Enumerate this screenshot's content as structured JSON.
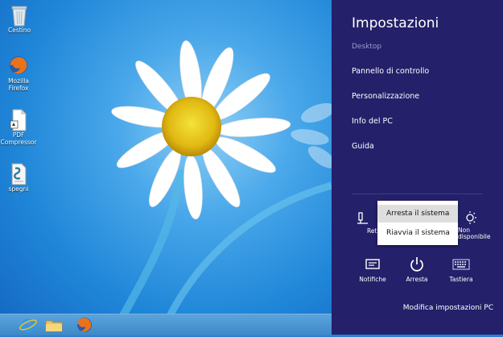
{
  "desktop": {
    "icons": [
      {
        "label": "Cestino"
      },
      {
        "label": "Mozilla Firefox"
      },
      {
        "label": "PDF Compressor"
      },
      {
        "label": "spegni"
      }
    ]
  },
  "panel": {
    "title": "Impostazioni",
    "subtitle": "Desktop",
    "links": [
      {
        "label": "Pannello di controllo"
      },
      {
        "label": "Personalizzazione"
      },
      {
        "label": "Info del PC"
      },
      {
        "label": "Guida"
      }
    ],
    "tiles": {
      "network_label_partial": "Ret",
      "brightness_label_partial": "Non\ndisponibile",
      "notifications_label": "Notifiche",
      "power_label": "Arresta",
      "keyboard_label": "Tastiera"
    },
    "footer": "Modifica impostazioni PC"
  },
  "power_menu": {
    "items": [
      {
        "label": "Arresta il sistema"
      },
      {
        "label": "Riavvia il sistema"
      }
    ]
  },
  "colors": {
    "panel_bg": "#24206a",
    "accent": "#ffffff",
    "subtitle": "#9c9acb"
  }
}
